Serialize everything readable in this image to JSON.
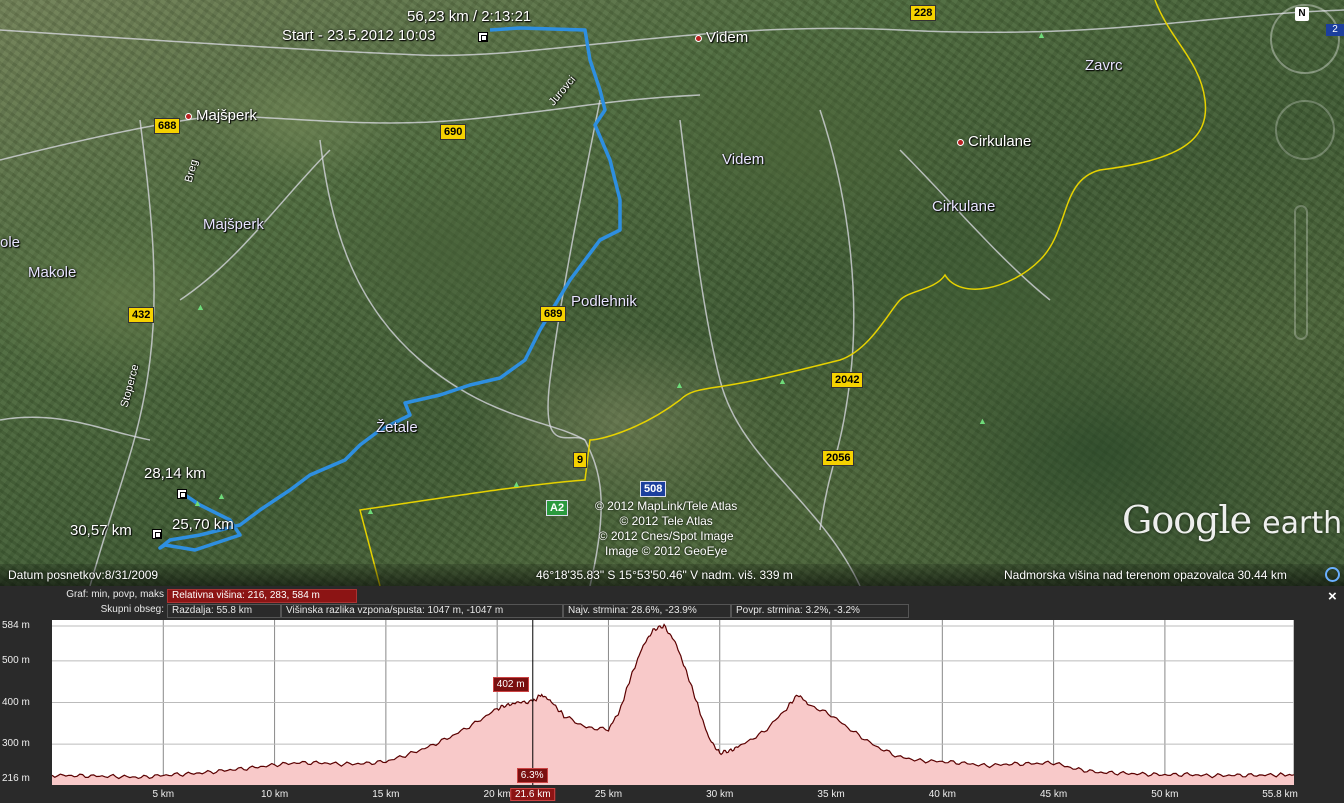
{
  "map": {
    "track": {
      "start_label": "Start - 23.5.2012 10:03",
      "end_summary": "56,23 km / 2:13:21",
      "markers": [
        "28,14 km",
        "25,70 km",
        "30,57 km"
      ]
    },
    "places": [
      {
        "name": "Videm",
        "kind": "town"
      },
      {
        "name": "Majšperk",
        "kind": "town"
      },
      {
        "name": "Cirkulane",
        "kind": "town"
      },
      {
        "name": "Zavrc",
        "kind": "region"
      },
      {
        "name": "Videm",
        "kind": "region"
      },
      {
        "name": "Cirkulane",
        "kind": "region"
      },
      {
        "name": "Majšperk",
        "kind": "region"
      },
      {
        "name": "ole",
        "kind": "region"
      },
      {
        "name": "Makole",
        "kind": "region"
      },
      {
        "name": "Podlehnik",
        "kind": "region"
      },
      {
        "name": "Žetale",
        "kind": "region"
      },
      {
        "name": "Jurovci",
        "kind": "street"
      },
      {
        "name": "Breg",
        "kind": "street"
      },
      {
        "name": "Stoperce",
        "kind": "street"
      }
    ],
    "roads": [
      "228",
      "688",
      "690",
      "432",
      "689",
      "2042",
      "2056",
      "9",
      "508",
      "A2"
    ],
    "copyright": [
      "© 2012 MapLink/Tele Atlas",
      "© 2012 Tele Atlas",
      "© 2012 Cnes/Spot Image",
      "Image © 2012 GeoEye"
    ],
    "logo": {
      "google": "Google",
      "earth": "earth"
    },
    "compass_letter": "N",
    "corner_badge": "2",
    "status": {
      "imagery_date": "Datum posnetkov:8/31/2009",
      "coordinates": "46°18'35.83\" S   15°53'50.46\" V  nadm. viš.   339 m",
      "eye_alt": "Nadmorska višina nad terenom opazovalca    30.44 km"
    }
  },
  "elevation": {
    "row1": {
      "key": "Graf: min, povp, maks",
      "value": "Relativna višina: 216, 283, 584 m"
    },
    "row2": {
      "key": "Skupni obseg:",
      "distance": "Razdalja: 55.8 km",
      "gain_loss": "Višinska razlika vzpona/spusta: 1047 m, -1047 m",
      "max_slope": "Najv. strmina: 28.6%, -23.9%",
      "avg_slope": "Povpr. strmina: 3.2%, -3.2%"
    },
    "close_label": "×",
    "cursor": {
      "elevation_label": "402 m",
      "slope_label": "6.3%",
      "distance_label": "21.6 km",
      "distance_km": 21.6
    },
    "colors": {
      "fill": "#f8c9c9",
      "line": "#5a0000",
      "flag": "#8c1414"
    }
  },
  "chart_data": {
    "type": "area",
    "title": "",
    "xlabel": "",
    "ylabel": "",
    "xlim": [
      0,
      55.8
    ],
    "ylim": [
      216,
      584
    ],
    "y_ticks": [
      216,
      300,
      400,
      500,
      584
    ],
    "y_tick_labels": [
      "216 m",
      "300 m",
      "400 m",
      "500 m",
      "584 m"
    ],
    "x_ticks": [
      5,
      10,
      15,
      20,
      25,
      30,
      35,
      40,
      45,
      50,
      55.8
    ],
    "x_tick_labels": [
      "5 km",
      "10 km",
      "15 km",
      "20 km",
      "25 km",
      "30 km",
      "35 km",
      "40 km",
      "45 km",
      "50 km",
      "55.8 km"
    ],
    "grid": true,
    "series": [
      {
        "x": [
          0,
          1,
          2,
          3,
          4,
          5,
          6,
          7,
          8,
          9,
          10,
          11,
          12,
          13,
          14,
          15,
          16,
          17,
          18,
          19,
          20,
          20.5,
          21,
          21.6,
          22,
          22.5,
          23,
          24,
          25,
          25.5,
          26,
          26.5,
          27,
          27.5,
          28,
          28.5,
          29,
          29.5,
          30,
          30.5,
          31,
          32,
          33,
          33.5,
          34,
          35,
          36,
          37,
          38,
          39,
          40,
          41,
          42,
          43,
          44,
          45,
          46,
          47,
          48,
          49,
          50,
          51,
          52,
          53,
          54,
          55,
          55.8
        ],
        "y": [
          225,
          224,
          223,
          222,
          220,
          225,
          228,
          232,
          238,
          243,
          250,
          255,
          255,
          252,
          253,
          258,
          275,
          295,
          320,
          350,
          385,
          395,
          400,
          402,
          420,
          398,
          368,
          340,
          335,
          380,
          460,
          530,
          575,
          584,
          545,
          475,
          395,
          315,
          278,
          285,
          298,
          330,
          385,
          420,
          395,
          370,
          330,
          295,
          270,
          260,
          258,
          254,
          248,
          252,
          253,
          255,
          240,
          232,
          230,
          228,
          226,
          227,
          224,
          225,
          225,
          226,
          226
        ]
      }
    ]
  }
}
